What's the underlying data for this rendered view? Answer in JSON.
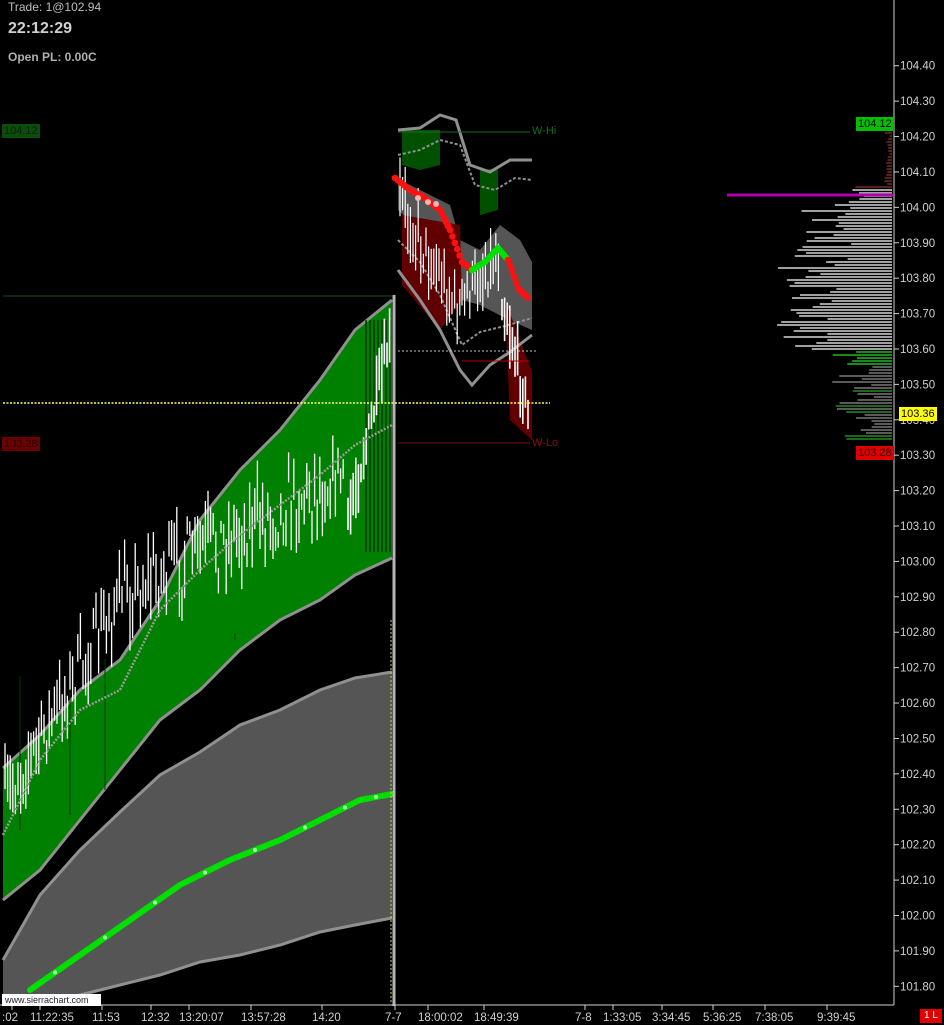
{
  "header": {
    "trade": "Trade: 1@102.94",
    "clock": "22:12:29",
    "open_pl": "Open PL: 0.00C"
  },
  "watermark": "www.sierrachart.com",
  "status_badge": "1 L",
  "price_scale": {
    "min": 101.75,
    "max": 104.58,
    "labels": [
      "104.40",
      "104.30",
      "104.20",
      "104.10",
      "104.00",
      "103.90",
      "103.80",
      "103.70",
      "103.60",
      "103.50",
      "103.40",
      "103.30",
      "103.20",
      "103.10",
      "103.00",
      "102.90",
      "102.80",
      "102.70",
      "102.60",
      "102.50",
      "102.40",
      "102.30",
      "102.20",
      "102.10",
      "102.00",
      "101.90",
      "101.80"
    ]
  },
  "time_axis": {
    "labels": [
      ":02",
      "11:22:35",
      "11:53",
      "12:32",
      "13:20:07",
      "13:57:28",
      "14:20",
      "7-7",
      "18:00:02",
      "18:49:39",
      "7-8",
      "1:33:05",
      "3:34:45",
      "5:36:25",
      "7:38:05",
      "9:39:45"
    ]
  },
  "markers": {
    "prev_high": {
      "label": "104.12",
      "price": 104.12
    },
    "prev_low": {
      "label": "103.28",
      "price": 103.28
    },
    "weekly_high": {
      "label": "W-Hi",
      "price": 104.12
    },
    "weekly_low": {
      "label": "W-Lo",
      "price": 103.28
    },
    "last_price": {
      "label": "103.36",
      "price": 103.395
    },
    "scale_high": {
      "label": "104.12",
      "price": 104.12
    },
    "scale_low": {
      "label": "103.28",
      "price": 103.28
    }
  },
  "colors": {
    "background": "#000000",
    "axis_text": "#d0d0d0",
    "green_band": "#008000",
    "dark_green": "#005000",
    "gray_band": "#555555",
    "band_line": "#909090",
    "candles": "#ffffff",
    "bright_green": "#00e000",
    "red": "#ff1010",
    "dark_red": "#600000",
    "last_price_line": "#ffff60",
    "profile_poc": "#b000b0",
    "high_tag": "#00c000",
    "low_tag": "#e00000",
    "last_tag": "#ffff00"
  }
}
